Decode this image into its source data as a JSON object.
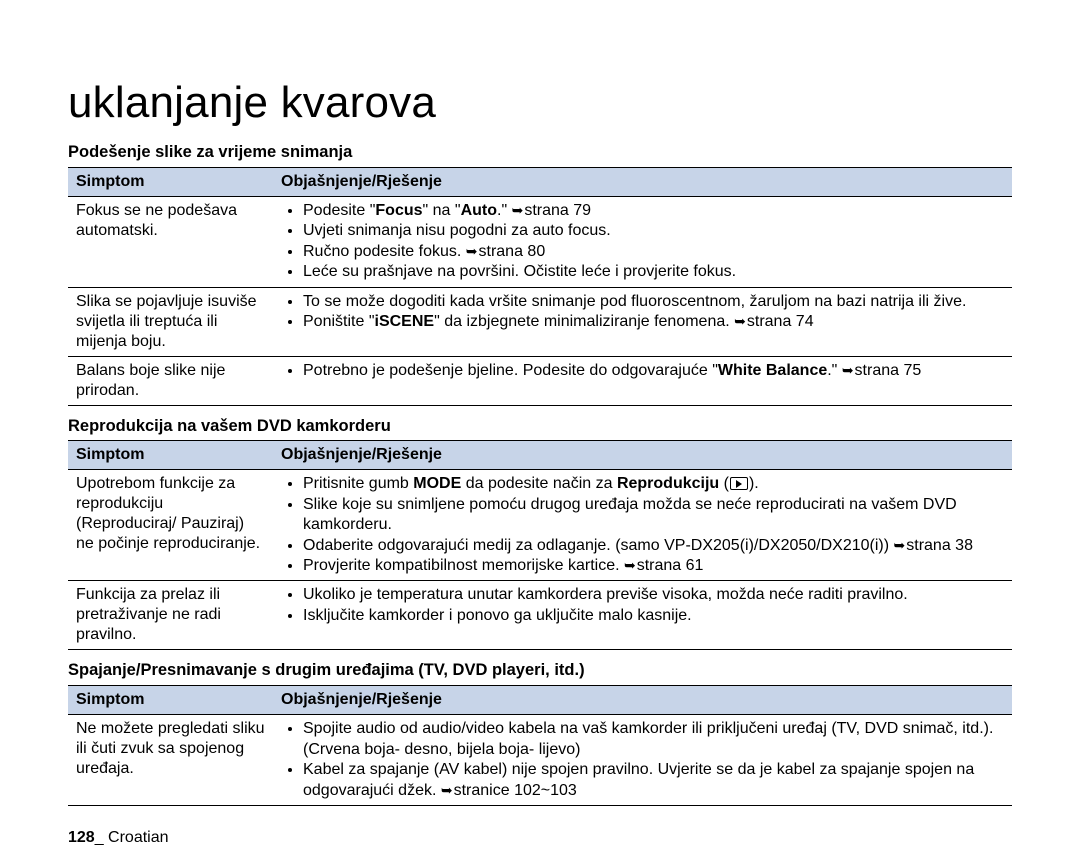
{
  "title": "uklanjanje kvarova",
  "sections": [
    {
      "heading": "Podešenje slike za vrijeme snimanja",
      "header": {
        "c1": "Simptom",
        "c2": "Objašnjenje/Rješenje"
      },
      "rows": [
        {
          "symptom": "Fokus se ne podešava automatski.",
          "items": [
            {
              "pre": "Podesite \"",
              "b1": "Focus",
              "mid": "\" na \"",
              "b2": "Auto",
              "post": ".\" ",
              "arrow": true,
              "page": "strana 79"
            },
            {
              "text": "Uvjeti snimanja nisu pogodni za auto focus."
            },
            {
              "pre": "Ručno podesite fokus. ",
              "arrow": true,
              "page": "strana 80"
            },
            {
              "text": "Leće su prašnjave na površini. Očistite leće i provjerite fokus."
            }
          ]
        },
        {
          "symptom": "Slika se pojavljuje isuviše svijetla ili treptuća ili mijenja boju.",
          "items": [
            {
              "text": "To se može dogoditi kada vršite snimanje pod fluoroscentnom, žaruljom na bazi natrija ili žive."
            },
            {
              "pre": "Poništite \"",
              "b1": "iSCENE",
              "post": "\" da izbjegnete minimaliziranje fenomena. ",
              "arrow": true,
              "page": "strana 74"
            }
          ]
        },
        {
          "symptom": "Balans boje slike nije prirodan.",
          "items": [
            {
              "pre": "Potrebno je podešenje bjeline. Podesite do odgovarajuće \"",
              "b1": "White Balance",
              "post": ".\" ",
              "arrow": true,
              "page": "strana 75"
            }
          ]
        }
      ]
    },
    {
      "heading": "Reprodukcija na vašem DVD kamkorderu",
      "header": {
        "c1": "Simptom",
        "c2": "Objašnjenje/Rješenje"
      },
      "rows": [
        {
          "symptom": "Upotrebom funkcije za reprodukciju (Reproduciraj/ Pauziraj) ne počinje reproduciranje.",
          "items": [
            {
              "pre": "Pritisnite gumb ",
              "b1": "MODE",
              "mid": " da podesite način za ",
              "b2": "Reprodukciju",
              "post": " (",
              "icon": "play",
              "post2": ")."
            },
            {
              "text": "Slike koje su snimljene pomoću drugog uređaja možda se neće reproducirati na vašem DVD kamkorderu."
            },
            {
              "pre": "Odaberite odgovarajući medij za odlaganje. (samo VP-DX205(i)/DX2050/DX210(i)) ",
              "arrow": true,
              "page": "strana 38"
            },
            {
              "pre": "Provjerite kompatibilnost memorijske kartice. ",
              "arrow": true,
              "page": "strana 61"
            }
          ]
        },
        {
          "symptom": "Funkcija za prelaz ili pretraživanje ne radi pravilno.",
          "items": [
            {
              "text": "Ukoliko je temperatura unutar kamkordera previše visoka, možda neće raditi pravilno."
            },
            {
              "text": "Isključite kamkorder i ponovo ga uključite malo kasnije."
            }
          ]
        }
      ]
    },
    {
      "heading": "Spajanje/Presnimavanje s drugim uređajima (TV, DVD playeri, itd.)",
      "header": {
        "c1": "Simptom",
        "c2": "Objašnjenje/Rješenje"
      },
      "rows": [
        {
          "symptom": "Ne možete pregledati sliku ili čuti zvuk sa spojenog uređaja.",
          "items": [
            {
              "text": "Spojite audio od audio/video kabela na vaš kamkorder ili priključeni uređaj (TV, DVD snimač, itd.). (Crvena boja- desno, bijela boja- lijevo)"
            },
            {
              "pre": "Kabel za spajanje (AV kabel) nije spojen pravilno. Uvjerite se da je kabel za spajanje spojen na odgovarajući džek. ",
              "arrow": true,
              "page": "stranice 102~103"
            }
          ]
        }
      ]
    }
  ],
  "footer": {
    "page": "128",
    "lang": "Croatian"
  }
}
